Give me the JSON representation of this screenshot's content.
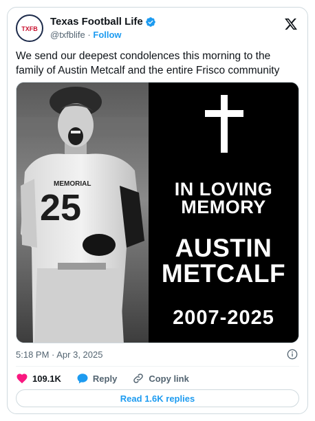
{
  "author": {
    "display_name": "Texas Football Life",
    "handle": "@txfblife",
    "separator": "·",
    "follow_label": "Follow",
    "avatar_text": "TXFB"
  },
  "tweet": {
    "text": "We send our deepest condolences this morning to the family of Austin Metcalf and the entire Frisco community",
    "timestamp": "5:18 PM · Apr 3, 2025"
  },
  "media": {
    "jersey_text": "MEMORIAL",
    "jersey_number": "25",
    "memorial_line1": "IN LOVING",
    "memorial_line2": "MEMORY",
    "name_line1": "AUSTIN",
    "name_line2": "METCALF",
    "years": "2007-2025"
  },
  "actions": {
    "likes": "109.1K",
    "reply_label": "Reply",
    "copy_label": "Copy link"
  },
  "replies_button": "Read 1.6K replies",
  "colors": {
    "accent": "#1d9bf0",
    "like": "#f91880",
    "text_secondary": "#536471"
  }
}
